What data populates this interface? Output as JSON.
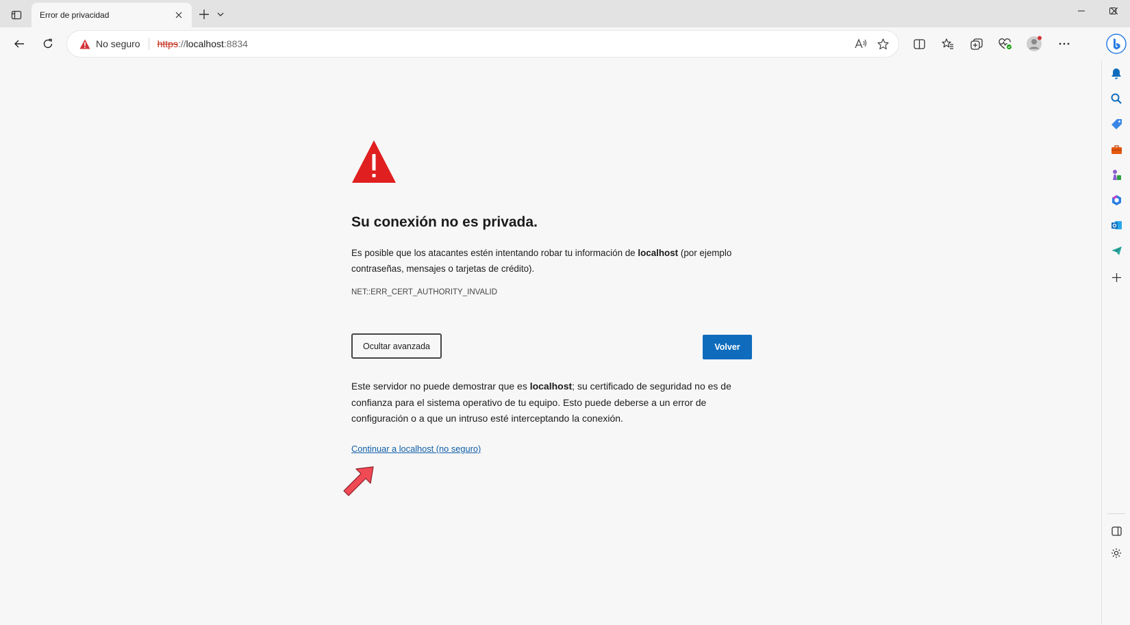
{
  "tab": {
    "title": "Error de privacidad"
  },
  "address_bar": {
    "security_label": "No seguro",
    "url_protocol": "https",
    "url_separator": "://",
    "url_host": "localhost",
    "url_port": ":8834"
  },
  "page": {
    "heading": "Su conexión no es privada.",
    "description_pre": "Es posible que los atacantes estén intentando robar tu información de ",
    "description_host": "localhost",
    "description_post": " (por ejemplo contraseñas, mensajes o tarjetas de crédito).",
    "error_code": "NET::ERR_CERT_AUTHORITY_INVALID",
    "advanced_button": "Ocultar avanzada",
    "back_button": "Volver",
    "detail_pre": "Este servidor no puede demostrar que es ",
    "detail_host": "localhost",
    "detail_post": "; su certificado de seguridad no es de confianza para el sistema operativo de tu equipo. Esto puede deberse a un error de configuración o a que un intruso esté interceptando la conexión.",
    "continue_link": "Continuar a localhost (no seguro)"
  },
  "colors": {
    "warning_red": "#e02020",
    "accent_blue": "#0f6cbd",
    "annotation_arrow": "#f04a55"
  },
  "icons": {
    "tab_actions": "tab-actions-icon",
    "back": "back-arrow-icon",
    "refresh": "refresh-icon",
    "read_aloud": "read-aloud-icon",
    "favorite": "star-icon",
    "split_screen": "split-screen-icon",
    "favorites": "favorites-icon",
    "collections": "collections-icon",
    "browser_essentials": "heart-pulse-icon",
    "profile": "profile-avatar-icon",
    "more": "more-icon",
    "copilot": "copilot-icon"
  }
}
